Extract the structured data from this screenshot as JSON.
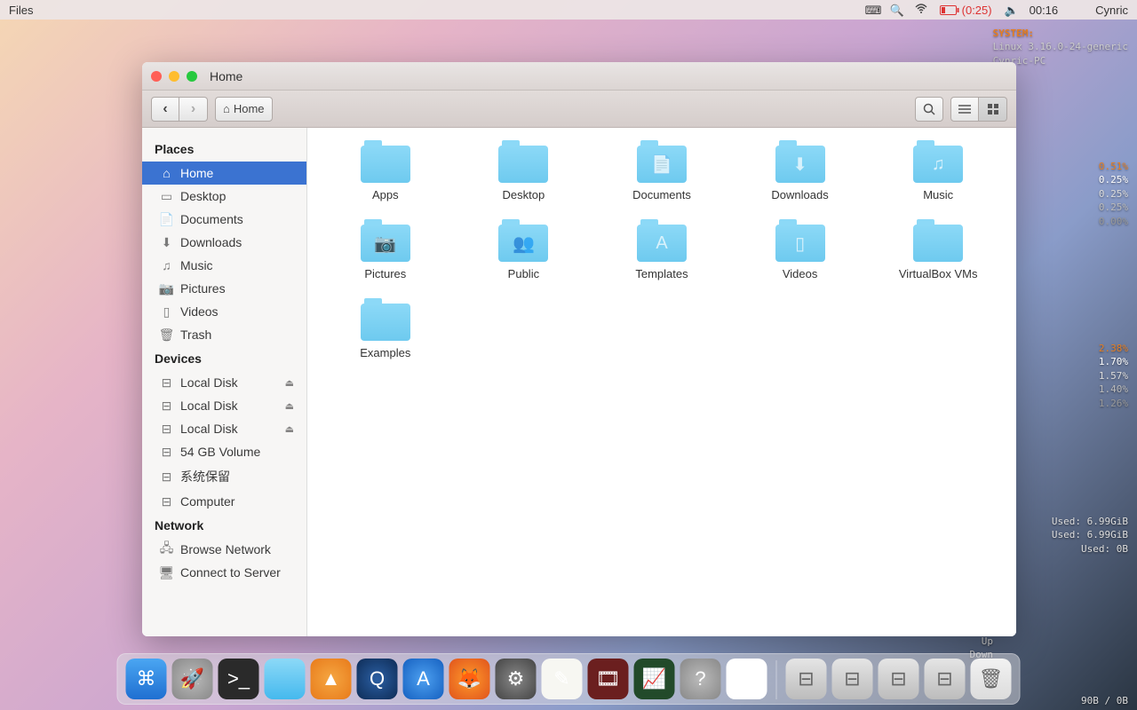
{
  "topbar": {
    "app": "Files",
    "battery": "(0:25)",
    "clock": "00:16",
    "user": "Cynric"
  },
  "overlay": {
    "title": "SYSTEM:",
    "kernel": "Linux 3.16.0-24-generic",
    "host": "Cynric-PC",
    "cpu": [
      "0.51%",
      "0.25%",
      "0.25%",
      "0.25%",
      "0.00%"
    ],
    "cpu2": [
      "2.38%",
      "1.70%",
      "1.57%",
      "1.40%",
      "1.26%"
    ],
    "mem": [
      "Used: 6.99GiB",
      "Used: 6.99GiB",
      "Used: 0B"
    ],
    "net_up": "Up",
    "net_down": "Down",
    "net_rate": "90B / 0B"
  },
  "window": {
    "title": "Home",
    "path": "Home",
    "nav_back": "‹",
    "nav_fwd": "›"
  },
  "sidebar": {
    "places_head": "Places",
    "places": [
      "Home",
      "Desktop",
      "Documents",
      "Downloads",
      "Music",
      "Pictures",
      "Videos",
      "Trash"
    ],
    "devices_head": "Devices",
    "devices": [
      "Local Disk",
      "Local Disk",
      "Local Disk",
      "54 GB Volume",
      "系统保留",
      "Computer"
    ],
    "device_ejectable": [
      true,
      true,
      true,
      false,
      false,
      false
    ],
    "network_head": "Network",
    "network": [
      "Browse Network",
      "Connect to Server"
    ]
  },
  "folders": [
    {
      "name": "Apps",
      "emblem": ""
    },
    {
      "name": "Desktop",
      "emblem": ""
    },
    {
      "name": "Documents",
      "emblem": "📄"
    },
    {
      "name": "Downloads",
      "emblem": "⬇"
    },
    {
      "name": "Music",
      "emblem": "♫"
    },
    {
      "name": "Pictures",
      "emblem": "📷"
    },
    {
      "name": "Public",
      "emblem": "👥"
    },
    {
      "name": "Templates",
      "emblem": "A"
    },
    {
      "name": "Videos",
      "emblem": "▯"
    },
    {
      "name": "VirtualBox VMs",
      "emblem": ""
    },
    {
      "name": "Examples",
      "emblem": ""
    }
  ],
  "dock": [
    {
      "name": "finder",
      "bg": "linear-gradient(#4aa6f2,#1f6fd1)",
      "glyph": "⌘"
    },
    {
      "name": "launcher",
      "bg": "radial-gradient(#bbb,#888)",
      "glyph": "🚀"
    },
    {
      "name": "terminal",
      "bg": "#2a2a2a",
      "glyph": ">_"
    },
    {
      "name": "files",
      "bg": "linear-gradient(#8cd9f7,#45b9ee)",
      "glyph": ""
    },
    {
      "name": "vlc",
      "bg": "radial-gradient(#f5a742,#e87a1a)",
      "glyph": "▲"
    },
    {
      "name": "quicktime",
      "bg": "radial-gradient(#2b5fa3,#0e2c56)",
      "glyph": "Q"
    },
    {
      "name": "appstore",
      "bg": "radial-gradient(#4da0f0,#1560c0)",
      "glyph": "A"
    },
    {
      "name": "firefox",
      "bg": "radial-gradient(#ff9a2b,#e0531c)",
      "glyph": "🦊"
    },
    {
      "name": "settings",
      "bg": "radial-gradient(#888,#444)",
      "glyph": "⚙"
    },
    {
      "name": "textedit",
      "bg": "#f7f7f2",
      "glyph": "✎"
    },
    {
      "name": "media",
      "bg": "#6b1f1f",
      "glyph": "🎞"
    },
    {
      "name": "monitor",
      "bg": "#224a2a",
      "glyph": "📈"
    },
    {
      "name": "help",
      "bg": "radial-gradient(#bbb,#888)",
      "glyph": "?"
    },
    {
      "name": "chrome",
      "bg": "#fff",
      "glyph": "◉"
    }
  ],
  "dock_right": [
    {
      "name": "drive1",
      "bg": "linear-gradient(#e5e5e5,#bcbcbc)",
      "glyph": "⊟"
    },
    {
      "name": "drive2",
      "bg": "linear-gradient(#e5e5e5,#bcbcbc)",
      "glyph": "⊟"
    },
    {
      "name": "drive3",
      "bg": "linear-gradient(#e5e5e5,#bcbcbc)",
      "glyph": "⊟"
    },
    {
      "name": "drive4",
      "bg": "linear-gradient(#e5e5e5,#bcbcbc)",
      "glyph": "⊟"
    },
    {
      "name": "trash",
      "bg": "linear-gradient(#f2f2f2,#dcdcdc)",
      "glyph": "🗑"
    }
  ]
}
